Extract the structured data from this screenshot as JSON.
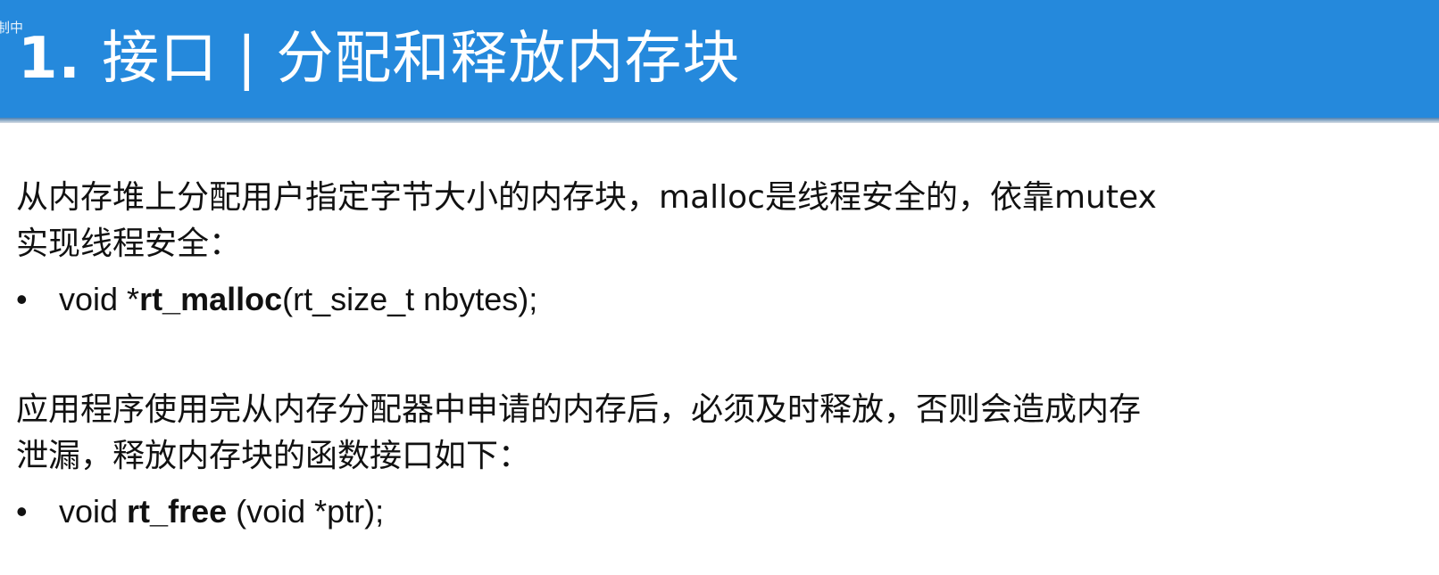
{
  "recording_indicator": "制中",
  "header": {
    "number": "1.",
    "title": "接口 | 分配和释放内存块"
  },
  "colors": {
    "header_bg": "#2589dc"
  },
  "sections": [
    {
      "text_line1": "从内存堆上分配用户指定字节大小的内存块，malloc是线程安全的，依靠mutex",
      "text_line2": "实现线程安全：",
      "bullet": {
        "prefix": "void *",
        "bold": "rt_malloc",
        "suffix": "(rt_size_t nbytes);"
      }
    },
    {
      "text_line1": "应用程序使用完从内存分配器中申请的内存后，必须及时释放，否则会造成内存",
      "text_line2": "泄漏，释放内存块的函数接口如下：",
      "bullet": {
        "prefix": "void ",
        "bold": "rt_free",
        "suffix": " (void *ptr);"
      }
    }
  ],
  "bullet_symbol": "•"
}
